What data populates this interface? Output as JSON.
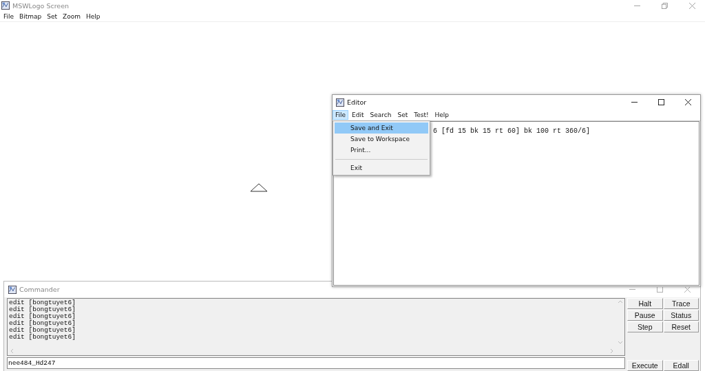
{
  "main_window": {
    "title": "MSWLogo Screen",
    "menu": [
      "File",
      "Bitmap",
      "Set",
      "Zoom",
      "Help"
    ]
  },
  "editor": {
    "title": "Editor",
    "menu": [
      {
        "label": "File",
        "selected": true
      },
      {
        "label": "Edit",
        "selected": false
      },
      {
        "label": "Search",
        "selected": false
      },
      {
        "label": "Set",
        "selected": false
      },
      {
        "label": "Test!",
        "selected": false
      },
      {
        "label": "Help",
        "selected": false
      }
    ],
    "file_menu": [
      {
        "kind": "item",
        "label": "Save and Exit",
        "selected": true
      },
      {
        "kind": "item",
        "label": "Save to Workspace",
        "selected": false
      },
      {
        "kind": "item",
        "label": "Print...",
        "selected": false
      },
      {
        "kind": "separator"
      },
      {
        "kind": "item",
        "label": "Exit",
        "selected": false
      }
    ],
    "code_line": "6 [fd 15 bk 15 rt 60] bk 100 rt 360/6]"
  },
  "commander": {
    "title": "Commander",
    "output_lines": [
      "edit [bongtuyet6]",
      "edit [bongtuyet6]",
      "edit [bongtuyet6]",
      "edit [bongtuyet6]",
      "edit [bongtuyet6]",
      "edit [bongtuyet6]"
    ],
    "input_value": "nee484_Hd247",
    "buttons": [
      "Halt",
      "Trace",
      "Pause",
      "Status",
      "Step",
      "Reset"
    ],
    "bottom_buttons": [
      "Execute",
      "Edall"
    ]
  }
}
